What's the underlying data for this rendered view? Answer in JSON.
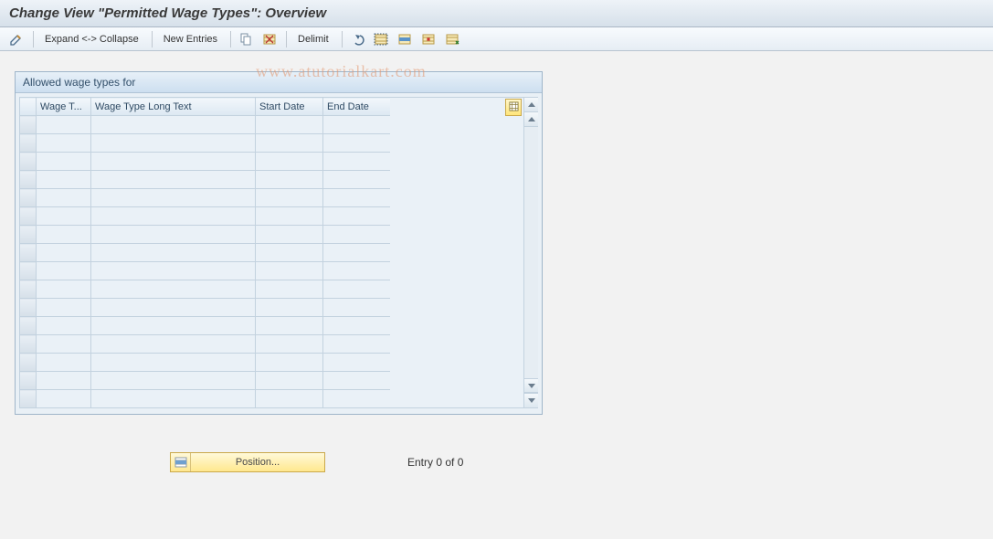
{
  "header": {
    "title": "Change View \"Permitted Wage Types\": Overview"
  },
  "toolbar": {
    "expand_collapse": "Expand <-> Collapse",
    "new_entries": "New Entries",
    "delimit": "Delimit"
  },
  "panel": {
    "title": "Allowed wage types for",
    "columns": {
      "wage_type": "Wage T...",
      "long_text": "Wage Type Long Text",
      "start_date": "Start Date",
      "end_date": "End Date"
    },
    "rows": [
      {
        "wage_type": "",
        "long_text": "",
        "start_date": "",
        "end_date": ""
      },
      {
        "wage_type": "",
        "long_text": "",
        "start_date": "",
        "end_date": ""
      },
      {
        "wage_type": "",
        "long_text": "",
        "start_date": "",
        "end_date": ""
      },
      {
        "wage_type": "",
        "long_text": "",
        "start_date": "",
        "end_date": ""
      },
      {
        "wage_type": "",
        "long_text": "",
        "start_date": "",
        "end_date": ""
      },
      {
        "wage_type": "",
        "long_text": "",
        "start_date": "",
        "end_date": ""
      },
      {
        "wage_type": "",
        "long_text": "",
        "start_date": "",
        "end_date": ""
      },
      {
        "wage_type": "",
        "long_text": "",
        "start_date": "",
        "end_date": ""
      },
      {
        "wage_type": "",
        "long_text": "",
        "start_date": "",
        "end_date": ""
      },
      {
        "wage_type": "",
        "long_text": "",
        "start_date": "",
        "end_date": ""
      },
      {
        "wage_type": "",
        "long_text": "",
        "start_date": "",
        "end_date": ""
      },
      {
        "wage_type": "",
        "long_text": "",
        "start_date": "",
        "end_date": ""
      },
      {
        "wage_type": "",
        "long_text": "",
        "start_date": "",
        "end_date": ""
      },
      {
        "wage_type": "",
        "long_text": "",
        "start_date": "",
        "end_date": ""
      },
      {
        "wage_type": "",
        "long_text": "",
        "start_date": "",
        "end_date": ""
      },
      {
        "wage_type": "",
        "long_text": "",
        "start_date": "",
        "end_date": ""
      }
    ]
  },
  "footer": {
    "position_label": "Position...",
    "entry_counter": "Entry 0 of 0"
  },
  "watermark": "www.atutorialkart.com"
}
